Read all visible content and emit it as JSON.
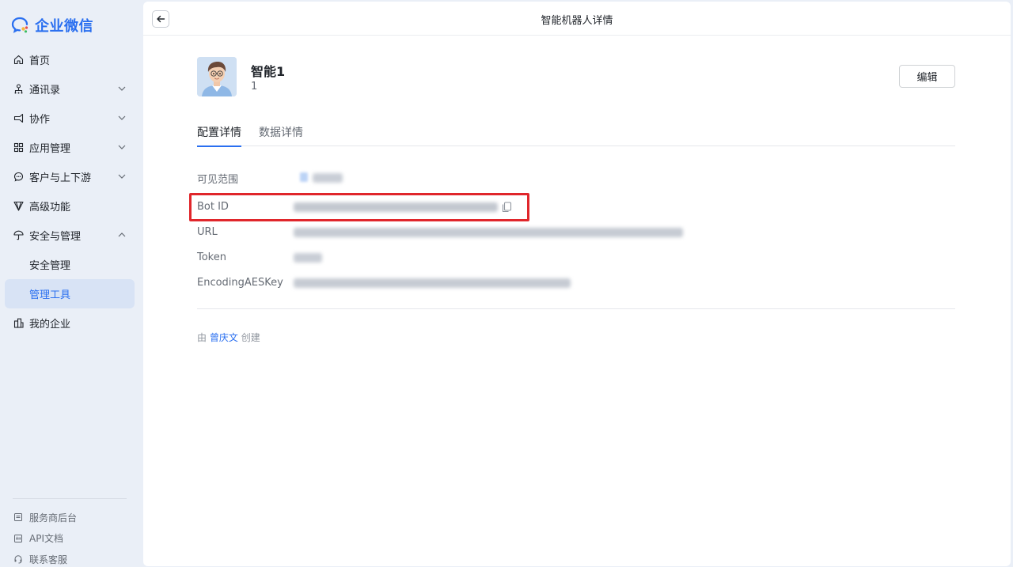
{
  "app": {
    "logo_text": "企业微信",
    "accent_color": "#2a6ff0",
    "highlight_color": "#e0262b"
  },
  "sidebar": {
    "items": [
      {
        "label": "首页",
        "icon": "home-icon",
        "expandable": false
      },
      {
        "label": "通讯录",
        "icon": "org-chart-icon",
        "expandable": true,
        "expanded": false
      },
      {
        "label": "协作",
        "icon": "collaboration-icon",
        "expandable": true,
        "expanded": false
      },
      {
        "label": "应用管理",
        "icon": "apps-grid-icon",
        "expandable": true,
        "expanded": false
      },
      {
        "label": "客户与上下游",
        "icon": "chat-bubble-icon",
        "expandable": true,
        "expanded": false
      },
      {
        "label": "高级功能",
        "icon": "diamond-icon",
        "expandable": false
      },
      {
        "label": "安全与管理",
        "icon": "umbrella-icon",
        "expandable": true,
        "expanded": true
      },
      {
        "label": "安全管理",
        "sub": true
      },
      {
        "label": "管理工具",
        "sub": true,
        "active": true
      },
      {
        "label": "我的企业",
        "icon": "building-icon",
        "expandable": false
      }
    ],
    "bottom_links": [
      {
        "label": "服务商后台",
        "icon": "document-icon"
      },
      {
        "label": "API文档",
        "icon": "api-doc-icon"
      },
      {
        "label": "联系客服",
        "icon": "headset-icon"
      }
    ]
  },
  "header": {
    "title": "智能机器人详情"
  },
  "bot": {
    "name": "智能1",
    "subtitle": "1",
    "edit_label": "编辑"
  },
  "tabs": [
    {
      "label": "配置详情",
      "active": true
    },
    {
      "label": "数据详情",
      "active": false
    }
  ],
  "fields": {
    "visible_scope": {
      "label": "可见范围"
    },
    "bot_id": {
      "label": "Bot ID"
    },
    "url": {
      "label": "URL"
    },
    "token": {
      "label": "Token"
    },
    "aes_key": {
      "label": "EncodingAESKey"
    }
  },
  "creator": {
    "prefix": "由",
    "name": "曾庆文",
    "suffix": "创建"
  }
}
